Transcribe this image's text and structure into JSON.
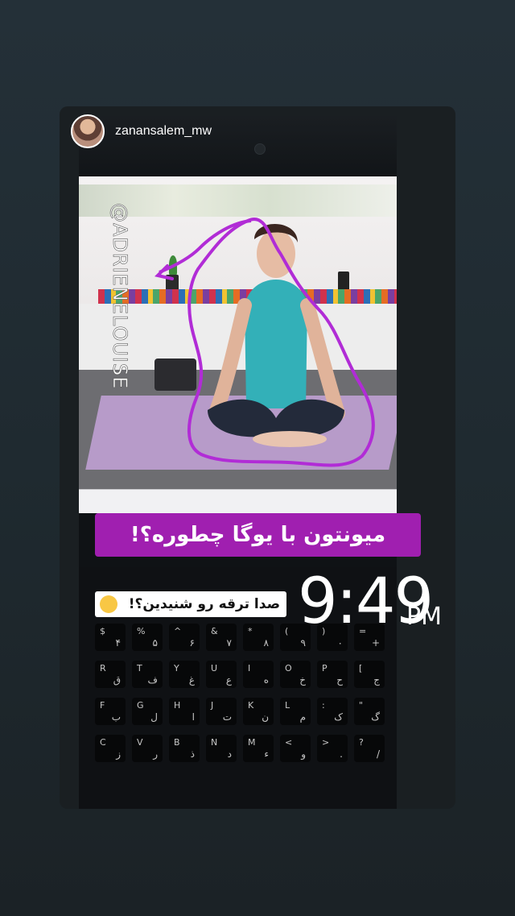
{
  "story": {
    "username": "zanansalem_mw",
    "caption": "میونتون با یوگا چطوره؟!",
    "question": "صدا ترقه رو شنیدین؟!",
    "time": "9:49",
    "ampm": "PM",
    "video_handle": "@ADRIENELOUISE"
  },
  "icons": {
    "avatar": "profile-photo",
    "emoji": "shocked-face-emoji"
  },
  "colors": {
    "caption_bg": "#a01fb0",
    "scribble": "#b12cd6",
    "background": "#243038"
  },
  "keyboard": [
    {
      "top": "$",
      "bottom": "۴"
    },
    {
      "top": "%",
      "bottom": "۵"
    },
    {
      "top": "^",
      "bottom": "۶"
    },
    {
      "top": "&",
      "bottom": "۷"
    },
    {
      "top": "*",
      "bottom": "۸"
    },
    {
      "top": "(",
      "bottom": "۹"
    },
    {
      "top": ")",
      "bottom": "۰"
    },
    {
      "top": "=",
      "bottom": "+"
    },
    {
      "top": "R",
      "bottom": "ق"
    },
    {
      "top": "T",
      "bottom": "ف"
    },
    {
      "top": "Y",
      "bottom": "غ"
    },
    {
      "top": "U",
      "bottom": "ع"
    },
    {
      "top": "I",
      "bottom": "ه"
    },
    {
      "top": "O",
      "bottom": "خ"
    },
    {
      "top": "P",
      "bottom": "ح"
    },
    {
      "top": "[",
      "bottom": "ج"
    },
    {
      "top": "F",
      "bottom": "ب"
    },
    {
      "top": "G",
      "bottom": "ل"
    },
    {
      "top": "H",
      "bottom": "ا"
    },
    {
      "top": "J",
      "bottom": "ت"
    },
    {
      "top": "K",
      "bottom": "ن"
    },
    {
      "top": "L",
      "bottom": "م"
    },
    {
      "top": ":",
      "bottom": "ک"
    },
    {
      "top": "\"",
      "bottom": "گ"
    },
    {
      "top": "C",
      "bottom": "ز"
    },
    {
      "top": "V",
      "bottom": "ر"
    },
    {
      "top": "B",
      "bottom": "ذ"
    },
    {
      "top": "N",
      "bottom": "د"
    },
    {
      "top": "M",
      "bottom": "ء"
    },
    {
      "top": "<",
      "bottom": "و"
    },
    {
      "top": ">",
      "bottom": "."
    },
    {
      "top": "?",
      "bottom": "/"
    }
  ]
}
